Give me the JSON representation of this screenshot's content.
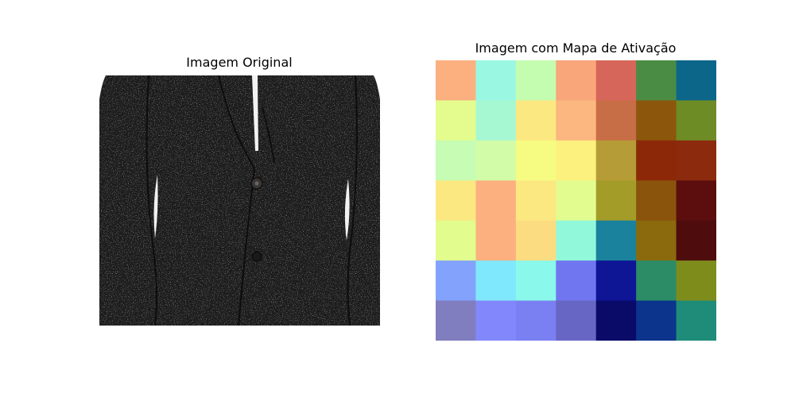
{
  "chart_data": [
    {
      "type": "image",
      "title": "Imagem Original",
      "content": "jacket-photo",
      "colors": {
        "jacket": "#1f1d1e",
        "lining": "#f2f2f2",
        "background": "#ffffff"
      }
    },
    {
      "type": "heatmap",
      "title": "Imagem com Mapa de Ativação",
      "rows": 7,
      "cols": 7,
      "colormap": "jet",
      "overlay_alpha": 0.5,
      "cells": [
        [
          "#fcb07f",
          "#9af8e2",
          "#c4fcb0",
          "#f8a67a",
          "#d6665a",
          "#4a8c44",
          "#0c668a"
        ],
        [
          "#e4fc8e",
          "#a6f8d2",
          "#fce880",
          "#fcb680",
          "#c86e46",
          "#8c560c",
          "#6e8c26"
        ],
        [
          "#c6fcb4",
          "#d2fca8",
          "#f6fc82",
          "#fcf07e",
          "#b69c36",
          "#8c2808",
          "#8c2a0e"
        ],
        [
          "#fce880",
          "#fcb080",
          "#fce880",
          "#e2fc90",
          "#a49c28",
          "#8a540c",
          "#5c0e0e"
        ],
        [
          "#e2fc8e",
          "#fcb080",
          "#fcdc80",
          "#92f8da",
          "#1a829c",
          "#8a6a0c",
          "#4e0c0c"
        ],
        [
          "#82a2fc",
          "#80e8fc",
          "#8af8ea",
          "#7076f0",
          "#0e1696",
          "#2c8c66",
          "#7e8c1c"
        ],
        [
          "#807ebe",
          "#8288fc",
          "#7a80f2",
          "#6866c4",
          "#0a0a68",
          "#0c348c",
          "#1e8c78"
        ]
      ]
    }
  ]
}
